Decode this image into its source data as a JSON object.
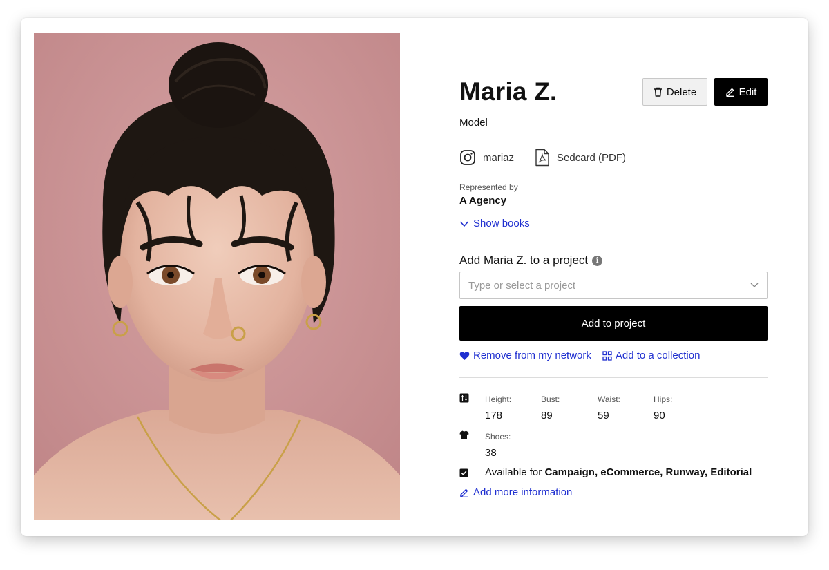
{
  "profile": {
    "name": "Maria Z.",
    "role": "Model",
    "instagram": "mariaz",
    "sedcard": "Sedcard (PDF)",
    "represented_by_label": "Represented by",
    "agency": "A Agency",
    "show_books": "Show books",
    "photo_icon": "portrait-photo"
  },
  "buttons": {
    "delete": "Delete",
    "edit": "Edit",
    "add_to_project": "Add to project"
  },
  "project": {
    "title": "Add Maria Z. to a project",
    "placeholder": "Type or select a project",
    "info_icon": "i"
  },
  "actions": {
    "remove_network": "Remove from my network",
    "add_collection": "Add to a collection",
    "add_more": "Add more information"
  },
  "measurements": {
    "height_label": "Height:",
    "height": "178",
    "bust_label": "Bust:",
    "bust": "89",
    "waist_label": "Waist:",
    "waist": "59",
    "hips_label": "Hips:",
    "hips": "90",
    "shoes_label": "Shoes:",
    "shoes": "38"
  },
  "availability": {
    "prefix": "Available for",
    "value": "Campaign, eCommerce, Runway, Editorial"
  },
  "colors": {
    "accent": "#1f2fd0",
    "photo_background": "#c99092",
    "button_dark": "#000000"
  },
  "icons": [
    "trash-icon",
    "pencil-icon",
    "instagram-icon",
    "pdf-icon",
    "chevron-down-icon",
    "info-icon",
    "heart-icon",
    "grid-icon",
    "ruler-icon",
    "tshirt-icon",
    "checkbox-icon"
  ]
}
